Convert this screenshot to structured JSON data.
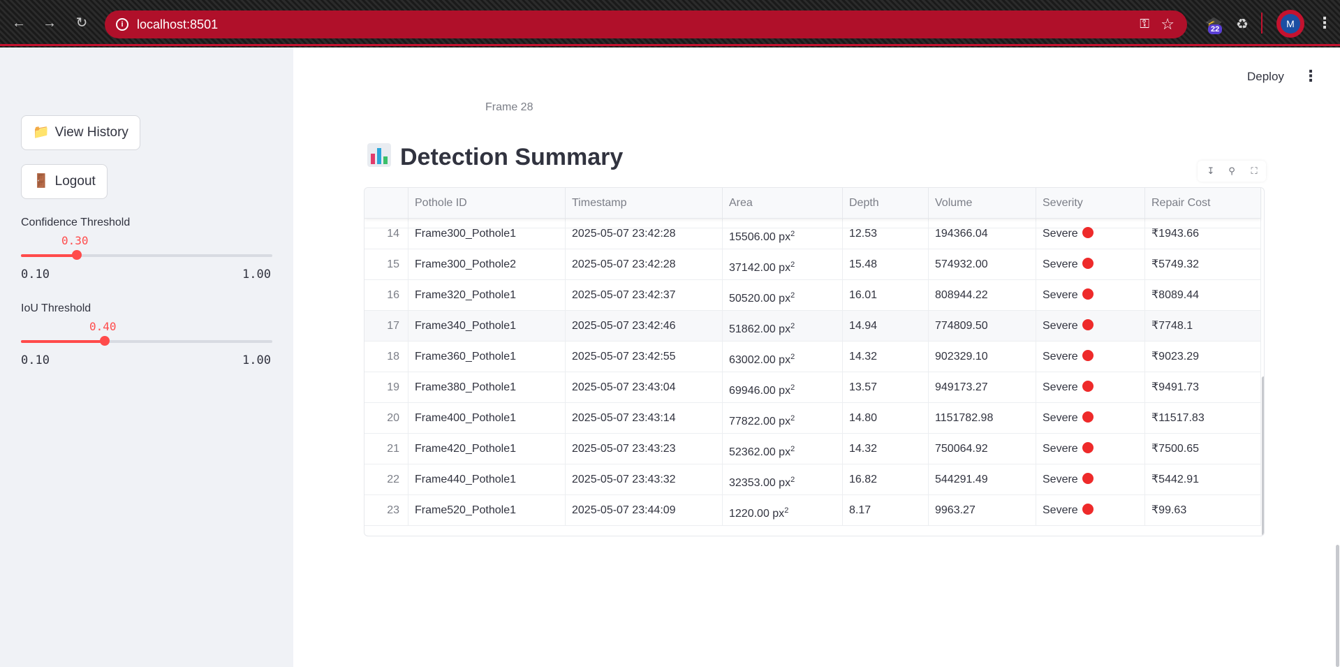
{
  "browser": {
    "url": "localhost:8501",
    "extension_badge": "22",
    "profile_initial": "M"
  },
  "sidebar": {
    "view_history_label": "View History",
    "logout_label": "Logout",
    "confidence": {
      "label": "Confidence Threshold",
      "value": "0.30",
      "min": "0.10",
      "max": "1.00",
      "fraction": 0.2222
    },
    "iou": {
      "label": "IoU Threshold",
      "value": "0.40",
      "min": "0.10",
      "max": "1.00",
      "fraction": 0.3333
    }
  },
  "header": {
    "deploy_label": "Deploy"
  },
  "main": {
    "frame_caption": "Frame 28",
    "title": "Detection Summary"
  },
  "table": {
    "columns": [
      "",
      "Pothole ID",
      "Timestamp",
      "Area",
      "Depth",
      "Volume",
      "Severity",
      "Repair Cost"
    ],
    "rows": [
      [
        "14",
        "Frame300_Pothole1",
        "2025-05-07 23:42:28",
        "15506.00 px",
        "12.53",
        "194366.04",
        "Severe",
        "₹1943.66"
      ],
      [
        "15",
        "Frame300_Pothole2",
        "2025-05-07 23:42:28",
        "37142.00 px",
        "15.48",
        "574932.00",
        "Severe",
        "₹5749.32"
      ],
      [
        "16",
        "Frame320_Pothole1",
        "2025-05-07 23:42:37",
        "50520.00 px",
        "16.01",
        "808944.22",
        "Severe",
        "₹8089.44"
      ],
      [
        "17",
        "Frame340_Pothole1",
        "2025-05-07 23:42:46",
        "51862.00 px",
        "14.94",
        "774809.50",
        "Severe",
        "₹7748.1"
      ],
      [
        "18",
        "Frame360_Pothole1",
        "2025-05-07 23:42:55",
        "63002.00 px",
        "14.32",
        "902329.10",
        "Severe",
        "₹9023.29"
      ],
      [
        "19",
        "Frame380_Pothole1",
        "2025-05-07 23:43:04",
        "69946.00 px",
        "13.57",
        "949173.27",
        "Severe",
        "₹9491.73"
      ],
      [
        "20",
        "Frame400_Pothole1",
        "2025-05-07 23:43:14",
        "77822.00 px",
        "14.80",
        "1151782.98",
        "Severe",
        "₹11517.83"
      ],
      [
        "21",
        "Frame420_Pothole1",
        "2025-05-07 23:43:23",
        "52362.00 px",
        "14.32",
        "750064.92",
        "Severe",
        "₹7500.65"
      ],
      [
        "22",
        "Frame440_Pothole1",
        "2025-05-07 23:43:32",
        "32353.00 px",
        "16.82",
        "544291.49",
        "Severe",
        "₹5442.91"
      ],
      [
        "23",
        "Frame520_Pothole1",
        "2025-05-07 23:44:09",
        "1220.00 px",
        "8.17",
        "9963.27",
        "Severe",
        "₹99.63"
      ]
    ],
    "area_unit_sup": "2"
  }
}
